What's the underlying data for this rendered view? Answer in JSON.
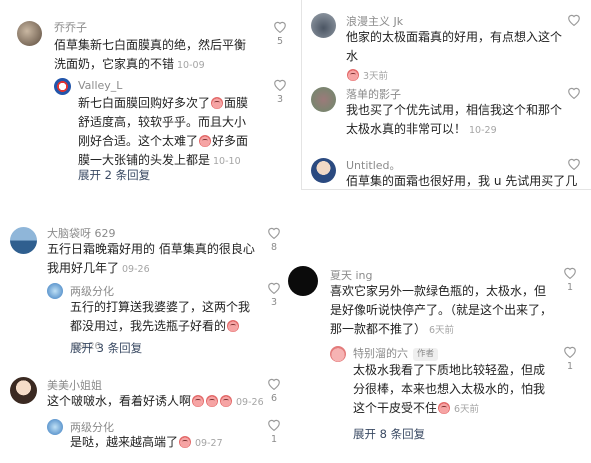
{
  "comments": [
    {
      "user": "乔乔子",
      "text": "佰草集新七白面膜真的绝，然后平衡洗面奶，它家真的不错",
      "time": "10-09",
      "likes": "5"
    },
    {
      "user": "Valley_L",
      "text_a": "新七白面膜回购好多次了",
      "text_b": "面膜舒适度高，较软乎乎。而且大小刚好合适。这个太难了",
      "text_c": "好多面膜一大张铺的头发上都是",
      "time": "10-10",
      "likes": "3"
    },
    {
      "user": "浪漫主义 Jk",
      "text": "他家的太极面霜真的好用，有点想入这个水",
      "time": "3天前"
    },
    {
      "user": "落单的影子",
      "text": "我也买了个优先试用，相信我这个和那个太极水真的非常可以！",
      "time": "10-29"
    },
    {
      "user": "Untitled。",
      "text": "佰草集的面霜也很好用，我 u 先试用买了几"
    },
    {
      "user": "大脑袋呀 629",
      "text": "五行日霜晚霜好用的 佰草集真的很良心 我用好几年了",
      "time": "09-26",
      "likes": "8"
    },
    {
      "user": "两级分化",
      "text": "五行的打算送我婆婆了，这两个我都没用过，我先选瓶子好看的",
      "time": "09-26",
      "likes": "3"
    },
    {
      "user": "夏天 ing",
      "text": "喜欢它家另外一款绿色瓶的，太极水，但是好像听说快停产了。（就是这个出来了，那一款都不推了）",
      "time": "6天前",
      "likes": "1"
    },
    {
      "user": "特别溜的六",
      "tag": "作者",
      "text": "太极水我看了下质地比较轻盈，但成分很棒，本来也想入太极水的，怕我这个干皮受不住",
      "time": "6天前",
      "likes": "1"
    },
    {
      "user": "美美小姐姐",
      "text": "这个啵啵水，看着好诱人啊",
      "time": "09-26",
      "likes": "6"
    },
    {
      "user": "两级分化",
      "text": "是哒，越来越高端了",
      "time": "09-27",
      "likes": "1"
    }
  ],
  "expands": {
    "e1": "展开 2 条回复",
    "e2": "展开 3 条回复",
    "e3": "展开 8 条回复"
  },
  "colors": {
    "heart": "#9a9a9a",
    "username": "#8b8b8b",
    "expand": "#3a4a63"
  }
}
